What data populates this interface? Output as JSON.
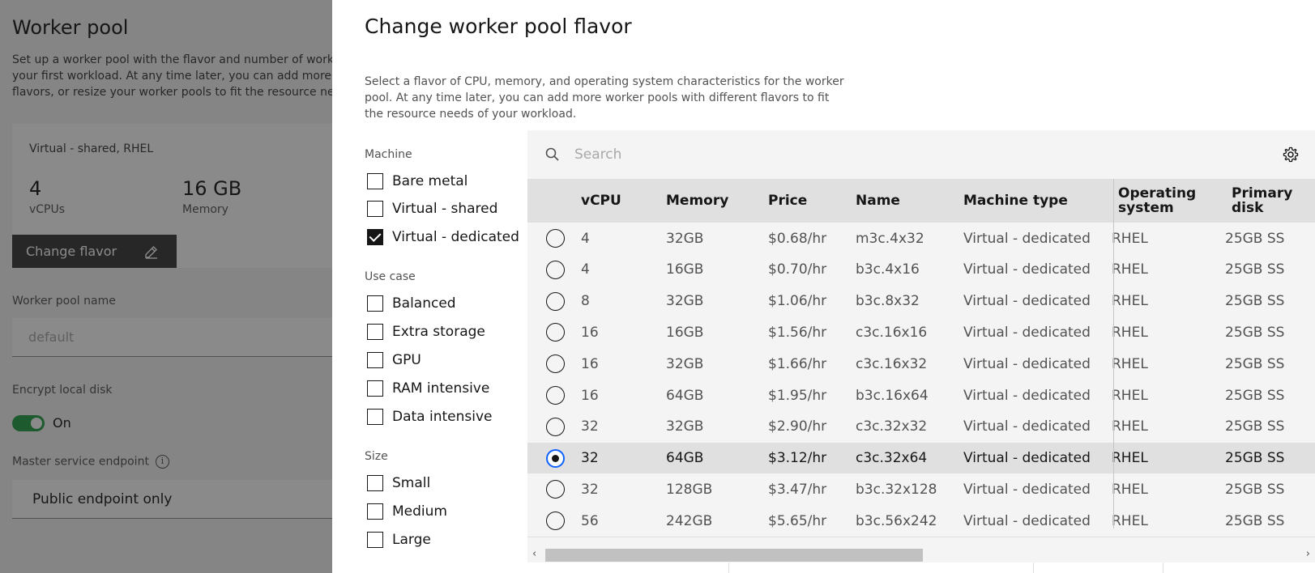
{
  "background": {
    "title": "Worker pool",
    "description_lines": [
      "Set up a worker pool with the flavor and number of work",
      "your first workload. At any time later, you can add more",
      "flavors, or resize your worker pools to fit the resource ne"
    ],
    "flavor_card": {
      "name": "Virtual - shared, RHEL",
      "vcpu_value": "4",
      "vcpu_label": "vCPUs",
      "memory_value": "16 GB",
      "memory_label": "Memory",
      "change_button": "Change flavor"
    },
    "worker_pool_name_label": "Worker pool name",
    "worker_pool_name_placeholder": "default",
    "encrypt_label": "Encrypt local disk",
    "encrypt_state": "On",
    "master_endpoint_label": "Master service endpoint",
    "master_endpoint_value": "Public endpoint only"
  },
  "modal": {
    "title": "Change worker pool flavor",
    "description_lines": [
      "Select a flavor of CPU, memory, and operating system characteristics for the worker",
      "pool. At any time later, you can add more worker pools with different flavors to fit",
      "the resource needs of your workload."
    ],
    "filters": {
      "machine": {
        "label": "Machine",
        "options": [
          {
            "label": "Bare metal",
            "checked": false
          },
          {
            "label": "Virtual - shared",
            "checked": false
          },
          {
            "label": "Virtual - dedicated",
            "checked": true
          }
        ]
      },
      "use_case": {
        "label": "Use case",
        "options": [
          {
            "label": "Balanced",
            "checked": false
          },
          {
            "label": "Extra storage",
            "checked": false
          },
          {
            "label": "GPU",
            "checked": false
          },
          {
            "label": "RAM intensive",
            "checked": false
          },
          {
            "label": "Data intensive",
            "checked": false
          }
        ]
      },
      "size": {
        "label": "Size",
        "options": [
          {
            "label": "Small",
            "checked": false
          },
          {
            "label": "Medium",
            "checked": false
          },
          {
            "label": "Large",
            "checked": false
          }
        ]
      }
    },
    "search_placeholder": "Search",
    "columns": [
      "vCPU",
      "Memory",
      "Price",
      "Name",
      "Machine type",
      "Operating\nsystem",
      "Primary\ndisk"
    ],
    "rows": [
      {
        "vcpu": "4",
        "memory": "32GB",
        "price": "$0.68/hr",
        "name": "m3c.4x32",
        "machine_type": "Virtual - dedicated",
        "os": "RHEL",
        "disk": "25GB SS",
        "selected": false
      },
      {
        "vcpu": "4",
        "memory": "16GB",
        "price": "$0.70/hr",
        "name": "b3c.4x16",
        "machine_type": "Virtual - dedicated",
        "os": "RHEL",
        "disk": "25GB SS",
        "selected": false
      },
      {
        "vcpu": "8",
        "memory": "32GB",
        "price": "$1.06/hr",
        "name": "b3c.8x32",
        "machine_type": "Virtual - dedicated",
        "os": "RHEL",
        "disk": "25GB SS",
        "selected": false
      },
      {
        "vcpu": "16",
        "memory": "16GB",
        "price": "$1.56/hr",
        "name": "c3c.16x16",
        "machine_type": "Virtual - dedicated",
        "os": "RHEL",
        "disk": "25GB SS",
        "selected": false
      },
      {
        "vcpu": "16",
        "memory": "32GB",
        "price": "$1.66/hr",
        "name": "c3c.16x32",
        "machine_type": "Virtual - dedicated",
        "os": "RHEL",
        "disk": "25GB SS",
        "selected": false
      },
      {
        "vcpu": "16",
        "memory": "64GB",
        "price": "$1.95/hr",
        "name": "b3c.16x64",
        "machine_type": "Virtual - dedicated",
        "os": "RHEL",
        "disk": "25GB SS",
        "selected": false
      },
      {
        "vcpu": "32",
        "memory": "32GB",
        "price": "$2.90/hr",
        "name": "c3c.32x32",
        "machine_type": "Virtual - dedicated",
        "os": "RHEL",
        "disk": "25GB SS",
        "selected": false
      },
      {
        "vcpu": "32",
        "memory": "64GB",
        "price": "$3.12/hr",
        "name": "c3c.32x64",
        "machine_type": "Virtual - dedicated",
        "os": "RHEL",
        "disk": "25GB SS",
        "selected": true
      },
      {
        "vcpu": "32",
        "memory": "128GB",
        "price": "$3.47/hr",
        "name": "b3c.32x128",
        "machine_type": "Virtual - dedicated",
        "os": "RHEL",
        "disk": "25GB SS",
        "selected": false
      },
      {
        "vcpu": "56",
        "memory": "242GB",
        "price": "$5.65/hr",
        "name": "b3c.56x242",
        "machine_type": "Virtual - dedicated",
        "os": "RHEL",
        "disk": "25GB SS",
        "selected": false
      }
    ]
  },
  "colors": {
    "accent": "#0f62fe",
    "toggle_on": "#24a148",
    "button_dark": "#393939"
  }
}
